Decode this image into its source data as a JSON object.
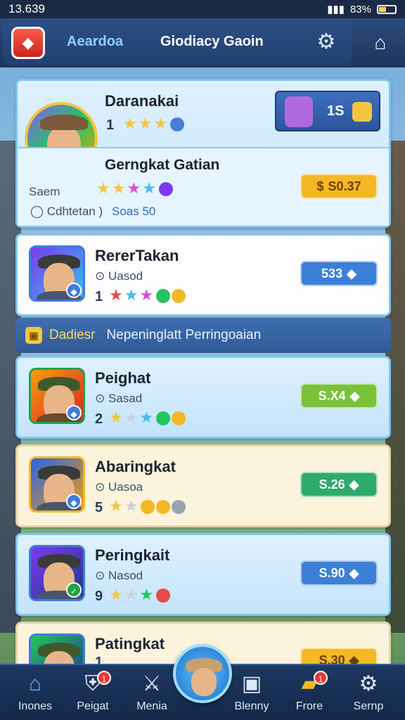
{
  "status_bar": {
    "time": "13.639",
    "battery": "83%"
  },
  "header": {
    "tab1": "Aeardoa",
    "tab2": "Giodiacy Gaoin"
  },
  "top_card": {
    "name": "Daranakai",
    "rank": "1",
    "coin_count": "1S",
    "subtitle": "Gerngkat Gatian",
    "label": "Saem",
    "meta_left": "Cdhtetan",
    "meta_right": "Soas 50",
    "price": "S0.37",
    "price_color": "#f4b824"
  },
  "cards": [
    {
      "name": "RererTakan",
      "sub": "Uasod",
      "rank": "1",
      "price": "533",
      "price_color": "#3c7fd6",
      "style": "white"
    },
    {
      "name": "Peighat",
      "sub": "Sasad",
      "rank": "2",
      "price": "S.X4",
      "price_color": "#7ac23a",
      "style": "blue"
    },
    {
      "name": "Abaringkat",
      "sub": "Uasoa",
      "rank": "5",
      "price": "S.26",
      "price_color": "#2eaa6a",
      "style": "cream"
    },
    {
      "name": "Peringkait",
      "sub": "Nasod",
      "rank": "9",
      "price": "S.90",
      "price_color": "#3c7fd6",
      "style": "blue"
    },
    {
      "name": "Patingkat",
      "sub": "",
      "rank": "1",
      "price": "S.30",
      "price_color": "#f4b824",
      "style": "cream"
    }
  ],
  "section": {
    "label": "Dadiesr",
    "title": "Nepeninglatt Perringoaian"
  },
  "nav": [
    {
      "label": "Inones",
      "icon": "home-icon"
    },
    {
      "label": "Peigat",
      "icon": "shield-icon",
      "badge": "1"
    },
    {
      "label": "Menia",
      "icon": "sword-icon"
    },
    {
      "label": "Blenny",
      "icon": "box-icon"
    },
    {
      "label": "Frore",
      "icon": "folder-icon",
      "badge": "1"
    },
    {
      "label": "Sernp",
      "icon": "gear-icon"
    }
  ]
}
